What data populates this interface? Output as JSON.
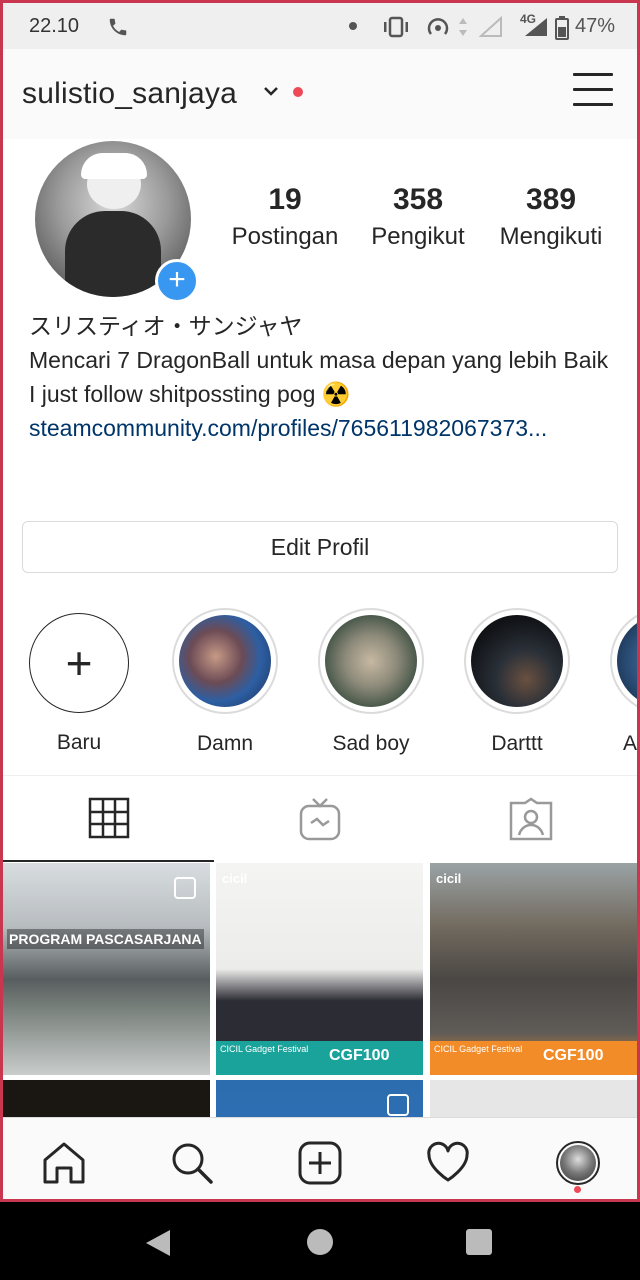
{
  "status_bar": {
    "time": "22.10",
    "battery": "47%",
    "network": "4G"
  },
  "header": {
    "username": "sulistio_sanjaya"
  },
  "profile": {
    "stats": [
      {
        "value": "19",
        "label": "Postingan"
      },
      {
        "value": "358",
        "label": "Pengikut"
      },
      {
        "value": "389",
        "label": "Mengikuti"
      }
    ],
    "name": "スリスティオ・サンジャヤ",
    "bio_line1": "Mencari 7 DragonBall untuk masa depan yang lebih Baik",
    "bio_line2": "I just follow shitpossting pog ☢️",
    "link": "steamcommunity.com/profiles/765611982067373...",
    "edit_label": "Edit Profil"
  },
  "highlights": [
    {
      "label": "Baru"
    },
    {
      "label": "Damn"
    },
    {
      "label": "Sad boy"
    },
    {
      "label": "Darttt"
    },
    {
      "label": "Ap"
    }
  ],
  "grid": {
    "post1_caption": "PROGRAM PASCASARJANA",
    "brand": "cicil",
    "promo_title": "CICIL Gadget Festival",
    "promo_code": "CGF100"
  },
  "colors": {
    "accent": "#3897f0",
    "notification": "#ed4956",
    "frame": "#c8364f"
  }
}
